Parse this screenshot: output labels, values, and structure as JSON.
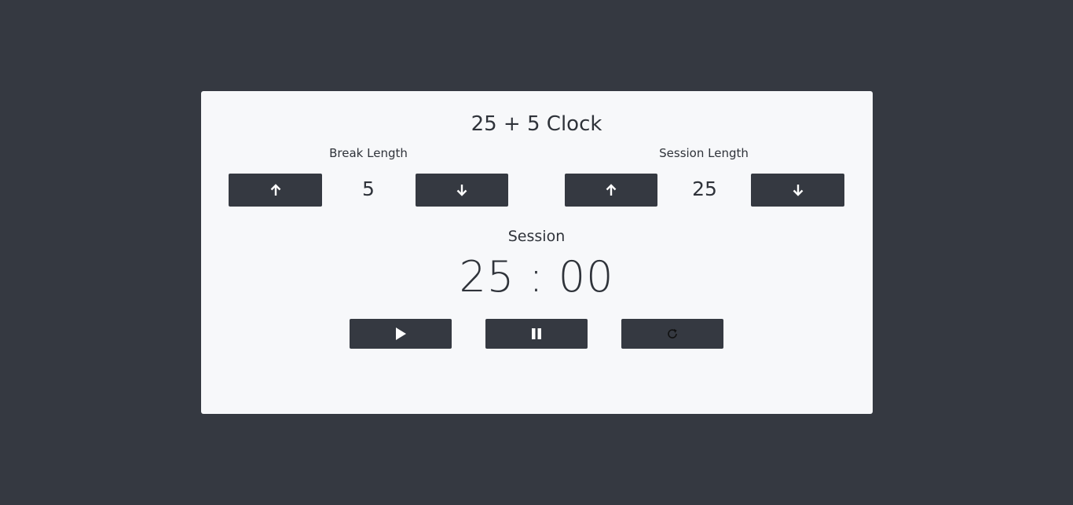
{
  "app": {
    "title": "25 + 5 Clock"
  },
  "break": {
    "label": "Break Length",
    "value": "5",
    "increment_icon": "arrow-up-icon",
    "decrement_icon": "arrow-down-icon"
  },
  "session": {
    "label": "Session Length",
    "value": "25",
    "increment_icon": "arrow-up-icon",
    "decrement_icon": "arrow-down-icon"
  },
  "timer": {
    "label": "Session",
    "display": "25 : 00"
  },
  "controls": {
    "play_icon": "play-icon",
    "pause_icon": "pause-icon",
    "reset_icon": "refresh-icon"
  },
  "colors": {
    "background": "#353941",
    "card": "#f7f8fa",
    "button": "#353941",
    "text": "#2f333a"
  }
}
